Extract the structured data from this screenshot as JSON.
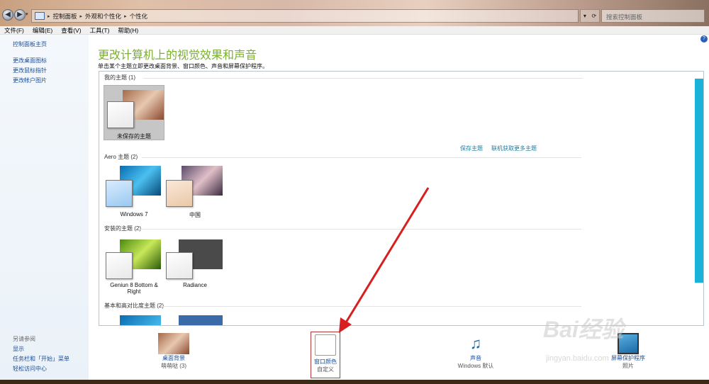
{
  "window": {
    "breadcrumbs": [
      "控制面板",
      "外观和个性化",
      "个性化"
    ],
    "search_placeholder": "搜索控制面板"
  },
  "menu": [
    "文件(F)",
    "编辑(E)",
    "查看(V)",
    "工具(T)",
    "帮助(H)"
  ],
  "sidebar": {
    "home_link": "控制面板主页",
    "links": [
      "更改桌面图标",
      "更改鼠标指针",
      "更改帐户图片"
    ],
    "see_also_title": "另请参阅",
    "see_also": [
      "显示",
      "任务栏和「开始」菜单",
      "轻松访问中心"
    ]
  },
  "main": {
    "title": "更改计算机上的视觉效果和声音",
    "subtitle": "单击某个主题立即更改桌面背景、窗口颜色、声音和屏幕保护程序。",
    "my_themes_label": "我的主题 (1)",
    "unsaved_theme": "未保存的主题",
    "save_theme_link": "保存主题",
    "online_link": "联机获取更多主题",
    "aero_label": "Aero 主题 (2)",
    "aero_themes": [
      "Windows 7",
      "中国"
    ],
    "installed_label": "安装的主题 (2)",
    "installed_themes": [
      "Geniun 8 Bottom & Right",
      "Radiance"
    ],
    "basic_label": "基本和高对比度主题 (2)"
  },
  "bottom": {
    "desktop_bg": {
      "label": "桌面背景",
      "sub": "萌萌哒 (3)"
    },
    "window_color": {
      "label": "窗口颜色",
      "sub": "自定义"
    },
    "sound": {
      "label": "声音",
      "sub": "Windows 默认"
    },
    "screensaver": {
      "label": "屏幕保护程序",
      "sub": "照片"
    }
  },
  "watermark": {
    "brand": "Bai经验",
    "url": "jingyan.baidu.com"
  },
  "colors": {
    "accent_green": "#7ab02e",
    "link_blue": "#1a4f9c",
    "scrollbar": "#1ab2d8",
    "arrow_red": "#d81e1e"
  }
}
